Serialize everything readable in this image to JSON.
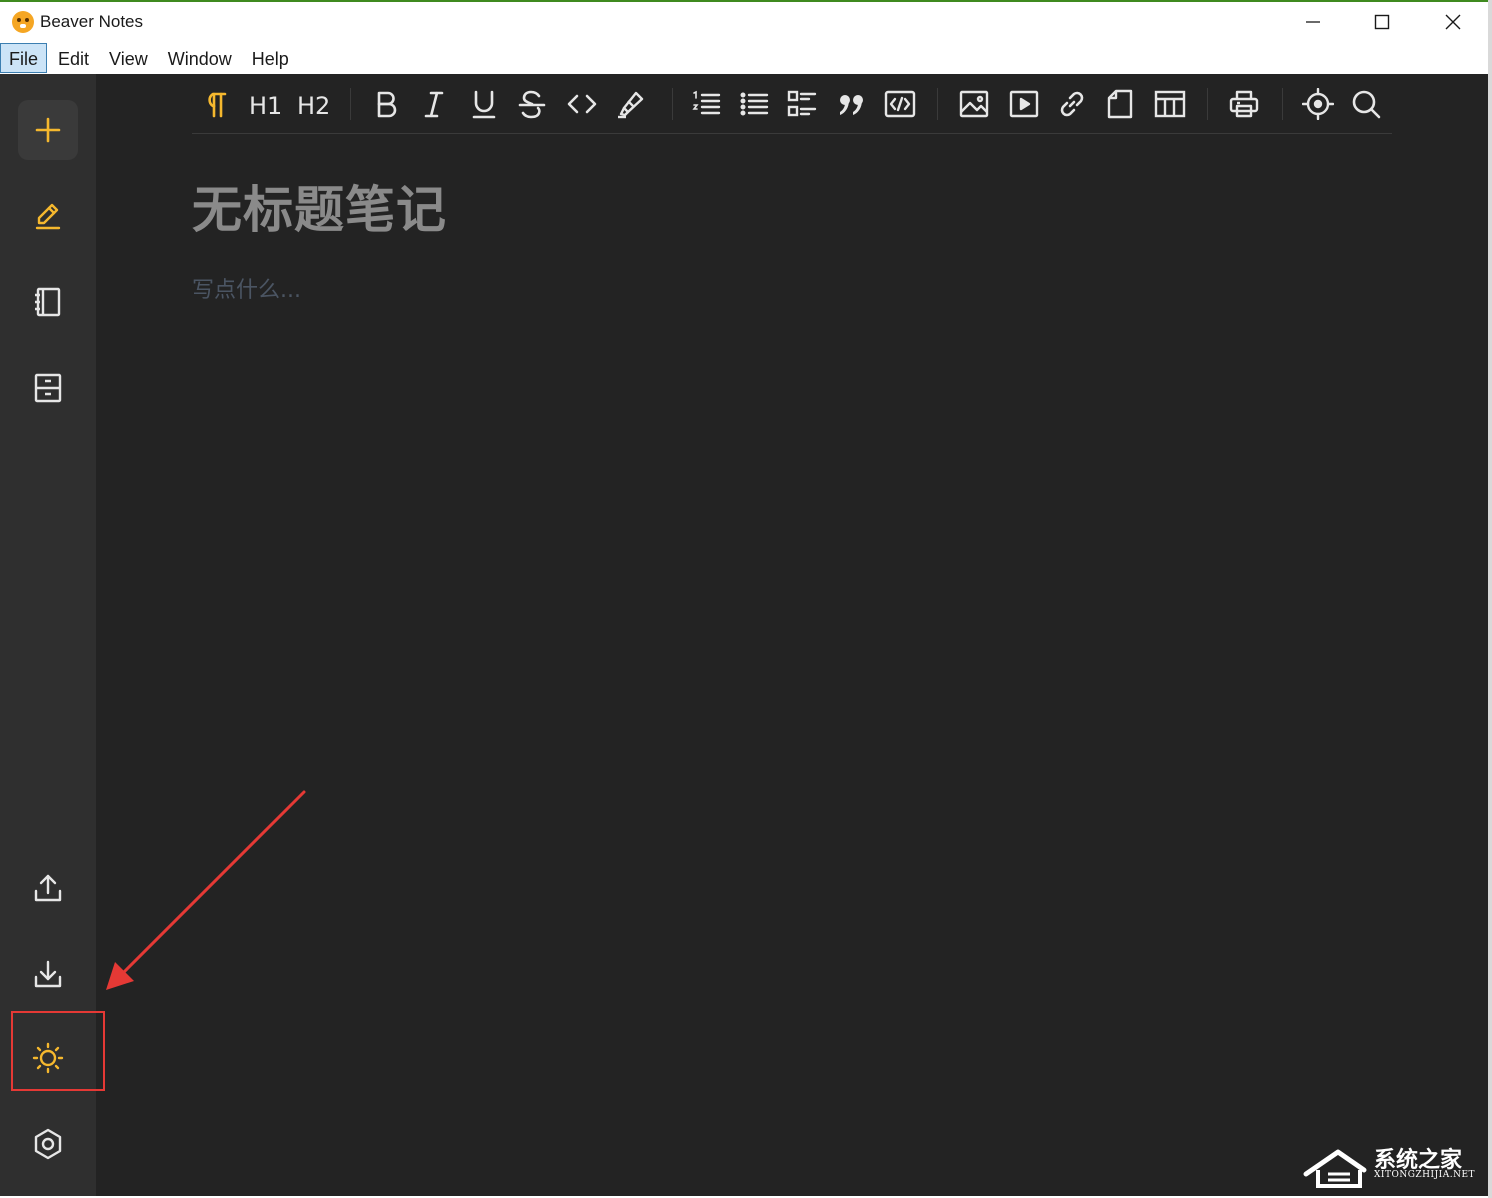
{
  "window": {
    "title": "Beaver Notes",
    "controls": [
      "minimize-icon",
      "maximize-icon",
      "close-icon"
    ]
  },
  "menu": {
    "items": [
      "File",
      "Edit",
      "View",
      "Window",
      "Help"
    ],
    "active": "File"
  },
  "sidebar": {
    "top": [
      {
        "name": "new-note",
        "icon": "plus-icon",
        "color": "#f5b82e"
      },
      {
        "name": "notes",
        "icon": "pencil-icon",
        "color": "#f5b82e",
        "active": true
      },
      {
        "name": "folders",
        "icon": "notebook-icon",
        "color": "#e6e6e6"
      },
      {
        "name": "archive",
        "icon": "archive-icon",
        "color": "#e6e6e6"
      }
    ],
    "bottom": [
      {
        "name": "export",
        "icon": "upload-icon",
        "color": "#e6e6e6"
      },
      {
        "name": "import",
        "icon": "download-icon",
        "color": "#e6e6e6"
      },
      {
        "name": "theme-toggle",
        "icon": "sun-icon",
        "color": "#f5b82e"
      },
      {
        "name": "settings",
        "icon": "settings-icon",
        "color": "#e6e6e6"
      }
    ]
  },
  "toolbar": {
    "groups": [
      [
        "paragraph-icon",
        "heading1-icon",
        "heading2-icon"
      ],
      [
        "bold-icon",
        "italic-icon",
        "underline-icon",
        "strikethrough-icon",
        "code-icon",
        "highlighter-icon"
      ],
      [
        "ordered-list-icon",
        "bullet-list-icon",
        "checklist-icon",
        "quote-icon",
        "code-block-icon"
      ],
      [
        "image-icon",
        "video-icon",
        "link-icon",
        "file-icon",
        "table-icon"
      ],
      [
        "print-icon"
      ],
      [
        "focus-icon",
        "search-icon"
      ]
    ],
    "labels": {
      "h1": "H1",
      "h2": "H2"
    },
    "active_color": "#f5b82e",
    "icon_color": "#e6e6e6"
  },
  "editor": {
    "title": "无标题笔记",
    "placeholder": "写点什么..."
  },
  "annotation": {
    "highlight_target": "theme-toggle",
    "color": "#e53935"
  },
  "watermark": {
    "main": "系统之家",
    "sub": "XITONGZHIJIA.NET"
  }
}
